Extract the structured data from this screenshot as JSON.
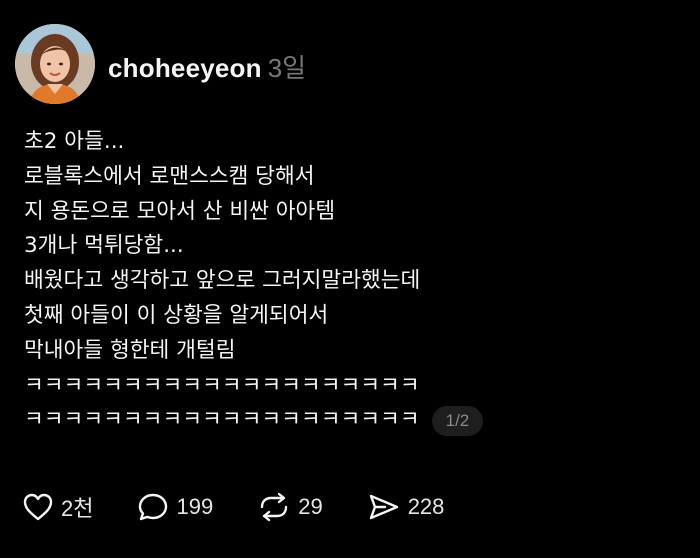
{
  "post": {
    "author": {
      "username": "choheeyeon",
      "timestamp": "3일"
    },
    "lines": [
      "초2 아들...",
      "로블록스에서 로맨스스캠 당해서",
      "지 용돈으로 모아서 산 비싼 아아템",
      "3개나 먹튀당함...",
      "배웠다고 생각하고 앞으로 그러지말라했는데",
      "첫째 아들이 이 상황을 알게되어서",
      "막내아들 형한테 개털림",
      "ㅋㅋㅋㅋㅋㅋㅋㅋㅋㅋㅋㅋㅋㅋㅋㅋㅋㅋㅋㅋ",
      "ㅋㅋㅋㅋㅋㅋㅋㅋㅋㅋㅋㅋㅋㅋㅋㅋㅋㅋㅋㅋ"
    ],
    "page_indicator": "1/2",
    "actions": {
      "like": {
        "icon": "heart-icon",
        "count": "2천"
      },
      "comment": {
        "icon": "comment-bubble-icon",
        "count": "199"
      },
      "repost": {
        "icon": "repost-icon",
        "count": "29"
      },
      "share": {
        "icon": "send-icon",
        "count": "228"
      }
    }
  },
  "colors": {
    "background": "#000000",
    "text": "#f3f5f7",
    "muted": "#777777",
    "badge_bg": "#1e1e1e"
  }
}
